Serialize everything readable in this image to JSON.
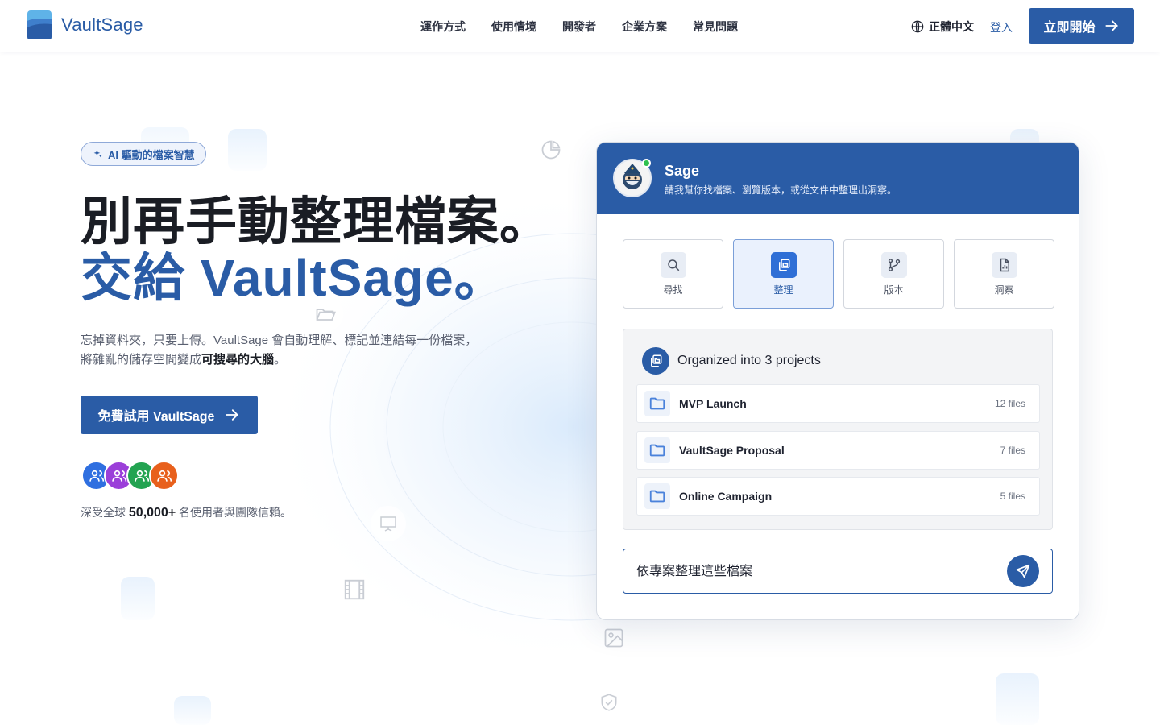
{
  "brand": {
    "name": "VaultSage",
    "accent": "#2a5ca6"
  },
  "nav": {
    "items": [
      {
        "label": "運作方式"
      },
      {
        "label": "使用情境"
      },
      {
        "label": "開發者"
      },
      {
        "label": "企業方案"
      },
      {
        "label": "常見問題"
      }
    ],
    "language": "正體中文",
    "login": "登入",
    "cta": "立即開始"
  },
  "hero": {
    "badge": "AI 驅動的檔案智慧",
    "title_line1": "別再手動整理檔案。",
    "title_line2": "交給 VaultSage。",
    "desc_line1": "忘掉資料夾，只要上傳。VaultSage 會自動理解、標記並連結每一份檔案，",
    "desc_line2_pre": "將雜亂的儲存空間變成",
    "desc_line2_bold": "可搜尋的大腦",
    "desc_line2_post": "。",
    "cta": "免費試用 VaultSage",
    "trust_pre": "深受全球 ",
    "trust_count": "50,000+",
    "trust_post": " 名使用者與團隊信賴。",
    "avatar_colors": [
      "#2f6fe0",
      "#9b3fd9",
      "#23a351",
      "#e8601c"
    ]
  },
  "chat": {
    "assistant_name": "Sage",
    "assistant_subtitle": "請我幫你找檔案、瀏覽版本，或從文件中整理出洞察。",
    "modes": [
      {
        "label": "尋找",
        "icon": "search-icon",
        "active": false
      },
      {
        "label": "整理",
        "icon": "organize-icon",
        "active": true
      },
      {
        "label": "版本",
        "icon": "branch-icon",
        "active": false
      },
      {
        "label": "洞察",
        "icon": "report-icon",
        "active": false
      }
    ],
    "result_title": "Organized into 3 projects",
    "projects": [
      {
        "name": "MVP Launch",
        "count": "12 files"
      },
      {
        "name": "VaultSage Proposal",
        "count": "7 files"
      },
      {
        "name": "Online Campaign",
        "count": "5 files"
      }
    ],
    "input_value": "依專案整理這些檔案"
  }
}
